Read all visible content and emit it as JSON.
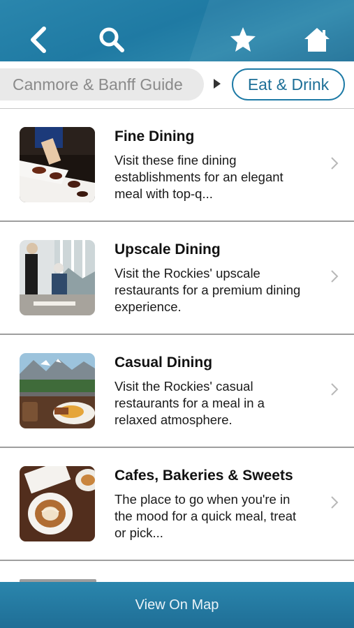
{
  "header": {
    "icons": [
      "back-arrow-icon",
      "search-icon",
      "star-icon",
      "home-icon"
    ]
  },
  "breadcrumb": {
    "parent": "Canmore & Banff Guide",
    "current": "Eat & Drink"
  },
  "list": [
    {
      "title": "Fine Dining",
      "description": "Visit these fine dining establishments for an elegant meal with top-q..."
    },
    {
      "title": "Upscale Dining",
      "description": "Visit the Rockies' upscale restaurants for a premium dining experience."
    },
    {
      "title": "Casual Dining",
      "description": "Visit the Rockies' casual restaurants for a meal in a relaxed atmosphere."
    },
    {
      "title": "Cafes, Bakeries & Sweets",
      "description": "The place to go when you're in the mood for a quick meal, treat or pick..."
    }
  ],
  "footer": {
    "map_button": "View On Map"
  },
  "colors": {
    "brand": "#1f7aa3",
    "accent_text": "#1d6f97"
  }
}
